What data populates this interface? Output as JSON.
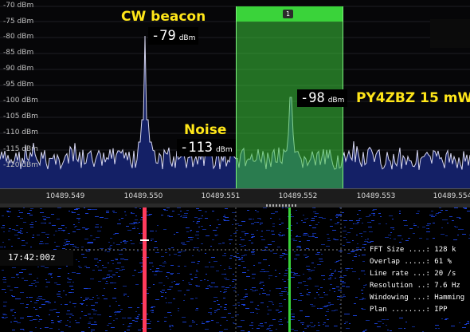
{
  "spectrum": {
    "db_labels": [
      "-70 dBm",
      "-75 dBm",
      "-80 dBm",
      "-85 dBm",
      "-90 dBm",
      "-95 dBm",
      "-100 dBm",
      "-105 dBm",
      "-110 dBm",
      "-115 dBm",
      "-120 dBm"
    ],
    "freq_labels": [
      "10489.549",
      "10489.550",
      "10489.551",
      "10489.552",
      "10489.553",
      "10489.554"
    ],
    "band_number": "1",
    "annotations": {
      "cw_title": "CW beacon",
      "cw_value": "-79",
      "noise_title": "Noise",
      "noise_value": "-113",
      "beacon_title": "PY4ZBZ 15 mW",
      "beacon_value": "-98",
      "unit": "dBm"
    }
  },
  "waterfall": {
    "timestamp": "17:42:00z",
    "fft_info": [
      "FFT Size ....: 128 k",
      "Overlap .....: 61 %",
      "Line rate ...: 20 /s",
      "Resolution ..: 7.6 Hz",
      "Windowing ...: Hamming",
      "Plan ........: IPP"
    ]
  },
  "colors": {
    "trace": "#d6d6f0",
    "fill": "#142066",
    "filter_band": "#3ad33a",
    "annotation": "#ffe619",
    "cw_marker": "#ff3b5c"
  }
}
